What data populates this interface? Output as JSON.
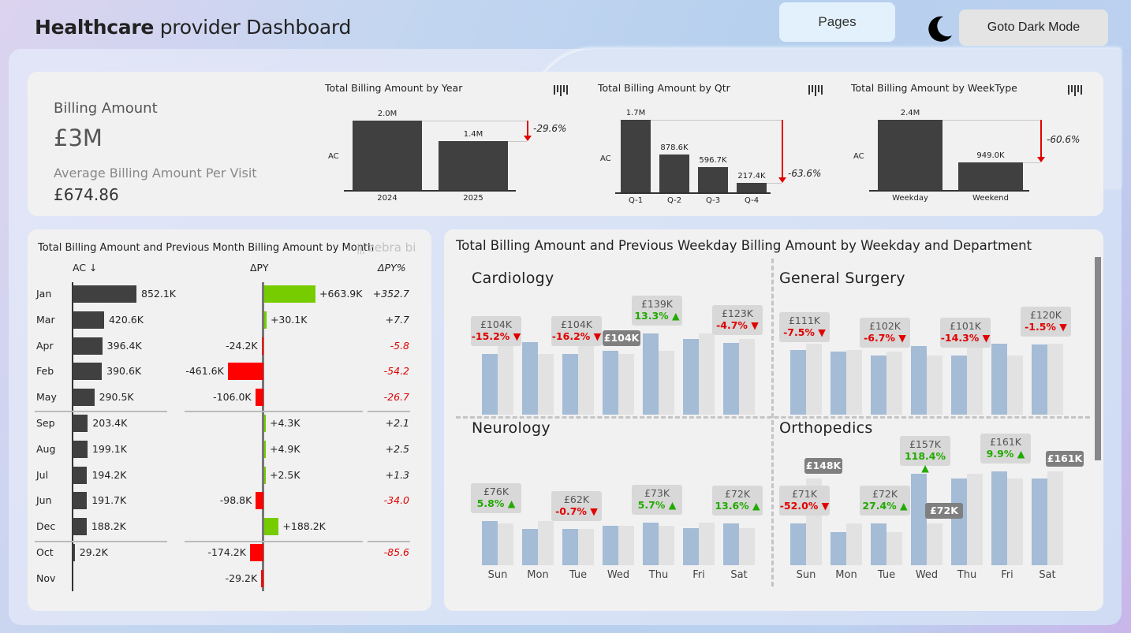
{
  "header": {
    "title_bold": "Healthcare",
    "title_rest": " provider Dashboard",
    "pages_label": "Pages",
    "dark_label": "Goto Dark Mode"
  },
  "kpi": {
    "title": "Billing Amount",
    "value": "£3M",
    "sub_label": "Average Billing Amount Per Visit",
    "sub_value": "£674.86"
  },
  "year_chart": {
    "title": "Total Billing Amount by Year",
    "row_label": "AC",
    "categories": [
      "2024",
      "2025"
    ],
    "values": [
      2.0,
      1.4
    ],
    "value_labels": [
      "2.0M",
      "1.4M"
    ],
    "delta": "-29.6%"
  },
  "qtr_chart": {
    "title": "Total Billing Amount by Qtr",
    "row_label": "AC",
    "categories": [
      "Q-1",
      "Q-2",
      "Q-3",
      "Q-4"
    ],
    "values": [
      1.7,
      0.8786,
      0.5967,
      0.2174
    ],
    "value_labels": [
      "1.7M",
      "878.6K",
      "596.7K",
      "217.4K"
    ],
    "delta": "-63.6%"
  },
  "week_chart": {
    "title": "Total Billing Amount by WeekType",
    "row_label": "AC",
    "categories": [
      "Weekday",
      "Weekend"
    ],
    "values": [
      2.4,
      0.949
    ],
    "value_labels": [
      "2.4M",
      "949.0K"
    ],
    "delta": "-60.6%"
  },
  "month_chart": {
    "title": "Total Billing Amount and Previous Month Billing Amount by Month",
    "brand": "zebra bi",
    "headers": {
      "ac": "AC ↓",
      "dpy": "ΔPY",
      "dpyp": "ΔPY%"
    },
    "rows": [
      {
        "m": "Jan",
        "ac": 852.1,
        "acl": "852.1K",
        "d": 663.9,
        "dl": "+663.9K",
        "p": "+352.7"
      },
      {
        "m": "Mar",
        "ac": 420.6,
        "acl": "420.6K",
        "d": 30.1,
        "dl": "+30.1K",
        "p": "+7.7"
      },
      {
        "m": "Apr",
        "ac": 396.4,
        "acl": "396.4K",
        "d": -24.2,
        "dl": "-24.2K",
        "p": "-5.8"
      },
      {
        "m": "Feb",
        "ac": 390.6,
        "acl": "390.6K",
        "d": -461.6,
        "dl": "-461.6K",
        "p": "-54.2"
      },
      {
        "m": "May",
        "ac": 290.5,
        "acl": "290.5K",
        "d": -106.0,
        "dl": "-106.0K",
        "p": "-26.7"
      },
      {
        "m": "Sep",
        "ac": 203.4,
        "acl": "203.4K",
        "d": 4.3,
        "dl": "+4.3K",
        "p": "+2.1"
      },
      {
        "m": "Aug",
        "ac": 199.1,
        "acl": "199.1K",
        "d": 4.9,
        "dl": "+4.9K",
        "p": "+2.5"
      },
      {
        "m": "Jul",
        "ac": 194.2,
        "acl": "194.2K",
        "d": 2.5,
        "dl": "+2.5K",
        "p": "+1.3"
      },
      {
        "m": "Jun",
        "ac": 191.7,
        "acl": "191.7K",
        "d": -98.8,
        "dl": "-98.8K",
        "p": "-34.0"
      },
      {
        "m": "Dec",
        "ac": 188.2,
        "acl": "188.2K",
        "d": 188.2,
        "dl": "+188.2K",
        "p": ""
      },
      {
        "m": "Oct",
        "ac": 29.2,
        "acl": "29.2K",
        "d": -174.2,
        "dl": "-174.2K",
        "p": "-85.6"
      },
      {
        "m": "Nov",
        "ac": 0,
        "acl": "",
        "d": -29.2,
        "dl": "-29.2K",
        "p": ""
      }
    ]
  },
  "dept_chart": {
    "title": "Total Billing Amount and Previous Weekday Billing Amount by Weekday and Department",
    "days": [
      "Sun",
      "Mon",
      "Tue",
      "Wed",
      "Thu",
      "Fri",
      "Sat"
    ],
    "panels": [
      {
        "name": "Cardiology",
        "ac": [
          104,
          125,
          104,
          110,
          139,
          130,
          123
        ],
        "py": [
          128,
          104,
          125,
          104,
          110,
          139,
          130
        ],
        "labels": [
          {
            "i": 0,
            "a": "£104K",
            "d": "-15.2% ▼",
            "up": false
          },
          {
            "i": 2,
            "a": "£104K",
            "d": "-16.2% ▼",
            "up": false
          },
          {
            "i": 4,
            "a": "£139K",
            "d": "13.3% ▲",
            "up": true
          },
          {
            "i": 6,
            "a": "£123K",
            "d": "-4.7% ▼",
            "up": false
          }
        ],
        "tags": [
          {
            "i": 3,
            "a": "£104K"
          }
        ]
      },
      {
        "name": "General Surgery",
        "ac": [
          111,
          108,
          102,
          118,
          101,
          122,
          120
        ],
        "py": [
          122,
          111,
          108,
          102,
          118,
          101,
          122
        ],
        "labels": [
          {
            "i": 0,
            "a": "£111K",
            "d": "-7.5% ▼",
            "up": false
          },
          {
            "i": 2,
            "a": "£102K",
            "d": "-6.7% ▼",
            "up": false
          },
          {
            "i": 4,
            "a": "£101K",
            "d": "-14.3% ▼",
            "up": false
          },
          {
            "i": 6,
            "a": "£120K",
            "d": "-1.5% ▼",
            "up": false
          }
        ],
        "tags": []
      },
      {
        "name": "Neurology",
        "ac": [
          76,
          62,
          62,
          68,
          73,
          63,
          72
        ],
        "py": [
          72,
          76,
          62,
          68,
          68,
          73,
          63
        ],
        "labels": [
          {
            "i": 0,
            "a": "£76K",
            "d": "5.8% ▲",
            "up": true
          },
          {
            "i": 2,
            "a": "£62K",
            "d": "-0.7% ▼",
            "up": false
          },
          {
            "i": 4,
            "a": "£73K",
            "d": "5.7% ▲",
            "up": true
          },
          {
            "i": 6,
            "a": "£72K",
            "d": "13.6% ▲",
            "up": true
          }
        ],
        "tags": []
      },
      {
        "name": "Orthopedics",
        "ac": [
          71,
          57,
          72,
          157,
          148,
          161,
          148
        ],
        "py": [
          148,
          71,
          57,
          72,
          157,
          148,
          161
        ],
        "labels": [
          {
            "i": 0,
            "a": "£71K",
            "d": "-52.0% ▼",
            "up": false
          },
          {
            "i": 2,
            "a": "£72K",
            "d": "27.4% ▲",
            "up": true
          },
          {
            "i": 3,
            "a": "£157K",
            "d": "118.4% ▲",
            "up": true
          },
          {
            "i": 5,
            "a": "£161K",
            "d": "9.9% ▲",
            "up": true
          }
        ],
        "tags": [
          {
            "i": 0,
            "a": "£148K",
            "py": true
          },
          {
            "i": 3,
            "a": "£72K",
            "py": true
          },
          {
            "i": 6,
            "a": "£161K",
            "py": true
          }
        ]
      }
    ]
  },
  "colors": {
    "ac_bar": "#404040",
    "pos": "#77cc00",
    "neg": "#ff0000",
    "dept_ac": "#a4bcd6",
    "dept_py": "#e2e2e2",
    "up": "#22aa00",
    "down": "#e00000"
  }
}
